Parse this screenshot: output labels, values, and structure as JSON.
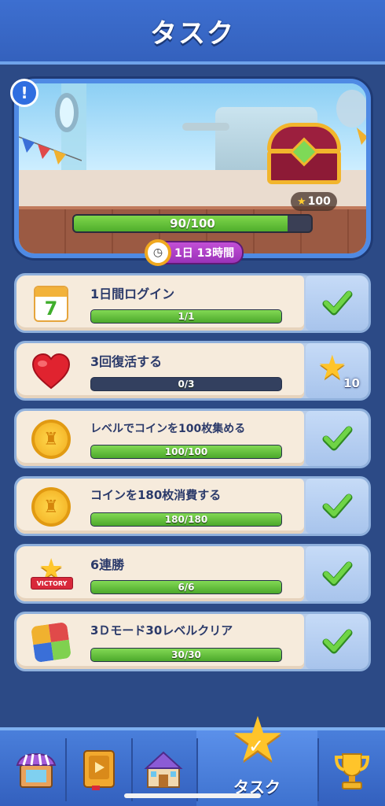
{
  "header": {
    "title": "タスク"
  },
  "banner": {
    "alert_mark": "!",
    "reward_amount": "100",
    "progress": {
      "text": "90/100",
      "fraction": 0.9
    },
    "timer": "1日 13時間"
  },
  "tasks": [
    {
      "title": "1日間ログイン",
      "progress_text": "1/1",
      "fraction": 1.0,
      "status": "complete",
      "icon": "calendar-icon",
      "icon_text": "7"
    },
    {
      "title": "3回復活する",
      "progress_text": "0/3",
      "fraction": 0.0,
      "status": "reward",
      "reward_amount": "10",
      "icon": "heart-icon"
    },
    {
      "title": "レベルでコインを100枚集める",
      "progress_text": "100/100",
      "fraction": 1.0,
      "status": "complete",
      "icon": "coin-icon"
    },
    {
      "title": "コインを180枚消費する",
      "progress_text": "180/180",
      "fraction": 1.0,
      "status": "complete",
      "icon": "coin-icon"
    },
    {
      "title": "6連勝",
      "progress_text": "6/6",
      "fraction": 1.0,
      "status": "complete",
      "icon": "victory-icon",
      "icon_text": "VICTORY"
    },
    {
      "title": "3Ｄモード30レベルクリア",
      "progress_text": "30/30",
      "fraction": 1.0,
      "status": "complete",
      "icon": "cube-icon"
    }
  ],
  "nav": {
    "items": [
      "shop-icon",
      "book-icon",
      "castle-icon",
      "task-star-icon",
      "trophy-icon"
    ],
    "active_label": "タスク"
  },
  "colors": {
    "accent": "#3d6fd0",
    "progress_green": "#4fae2c",
    "check_green": "#5fc63a",
    "star": "#ffc42a"
  }
}
